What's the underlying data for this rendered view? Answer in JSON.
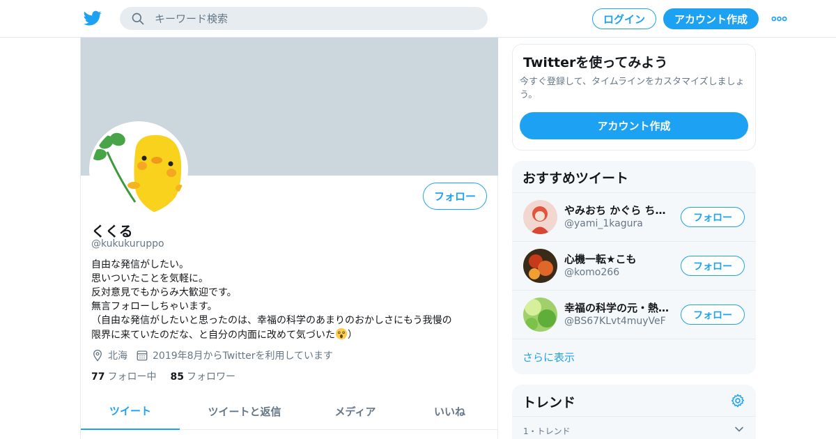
{
  "header": {
    "search_placeholder": "キーワード検索",
    "login_label": "ログイン",
    "signup_label": "アカウント作成"
  },
  "profile": {
    "name": "くくる",
    "handle": "@kukukuruppo",
    "follow_label": "フォロー",
    "bio": [
      "自由な発信がしたい。",
      "思いついたことを気軽に。",
      "反対意見でもからみ大歓迎です。",
      "無言フォローしちゃいます。",
      "（自由な発信がしたいと思ったのは、幸福の科学のあまりのおかしさにもう我慢の",
      "限界に来ていたのだな、と自分の内面に改めて気づいた",
      "）"
    ],
    "location": "北海",
    "joined": "2019年8月からTwitterを利用しています",
    "following_count": "77",
    "following_label": "フォロー中",
    "followers_count": "85",
    "followers_label": "フォロワー"
  },
  "tabs": [
    "ツイート",
    "ツイートと返信",
    "メディア",
    "いいね"
  ],
  "join_card": {
    "title": "Twitterを使ってみよう",
    "text": "今すぐ登録して、タイムラインをカスタマイズしましょう。",
    "button": "アカウント作成"
  },
  "recommended": {
    "title": "おすすめツイート",
    "follow_label": "フォロー",
    "accounts": [
      {
        "name": "やみおち かぐら ち…",
        "handle": "@yami_1kagura"
      },
      {
        "name": "心機一転★こも",
        "handle": "@komo266"
      },
      {
        "name": "幸福の科学の元・熱…",
        "handle": "@BS67KLvt4muyVeF"
      }
    ],
    "show_more": "さらに表示"
  },
  "trends": {
    "title": "トレンド",
    "first_meta": "1・トレンド"
  },
  "colors": {
    "accent": "#1da1f2",
    "banner": "#ccd6dd",
    "muted_text": "#657786"
  }
}
